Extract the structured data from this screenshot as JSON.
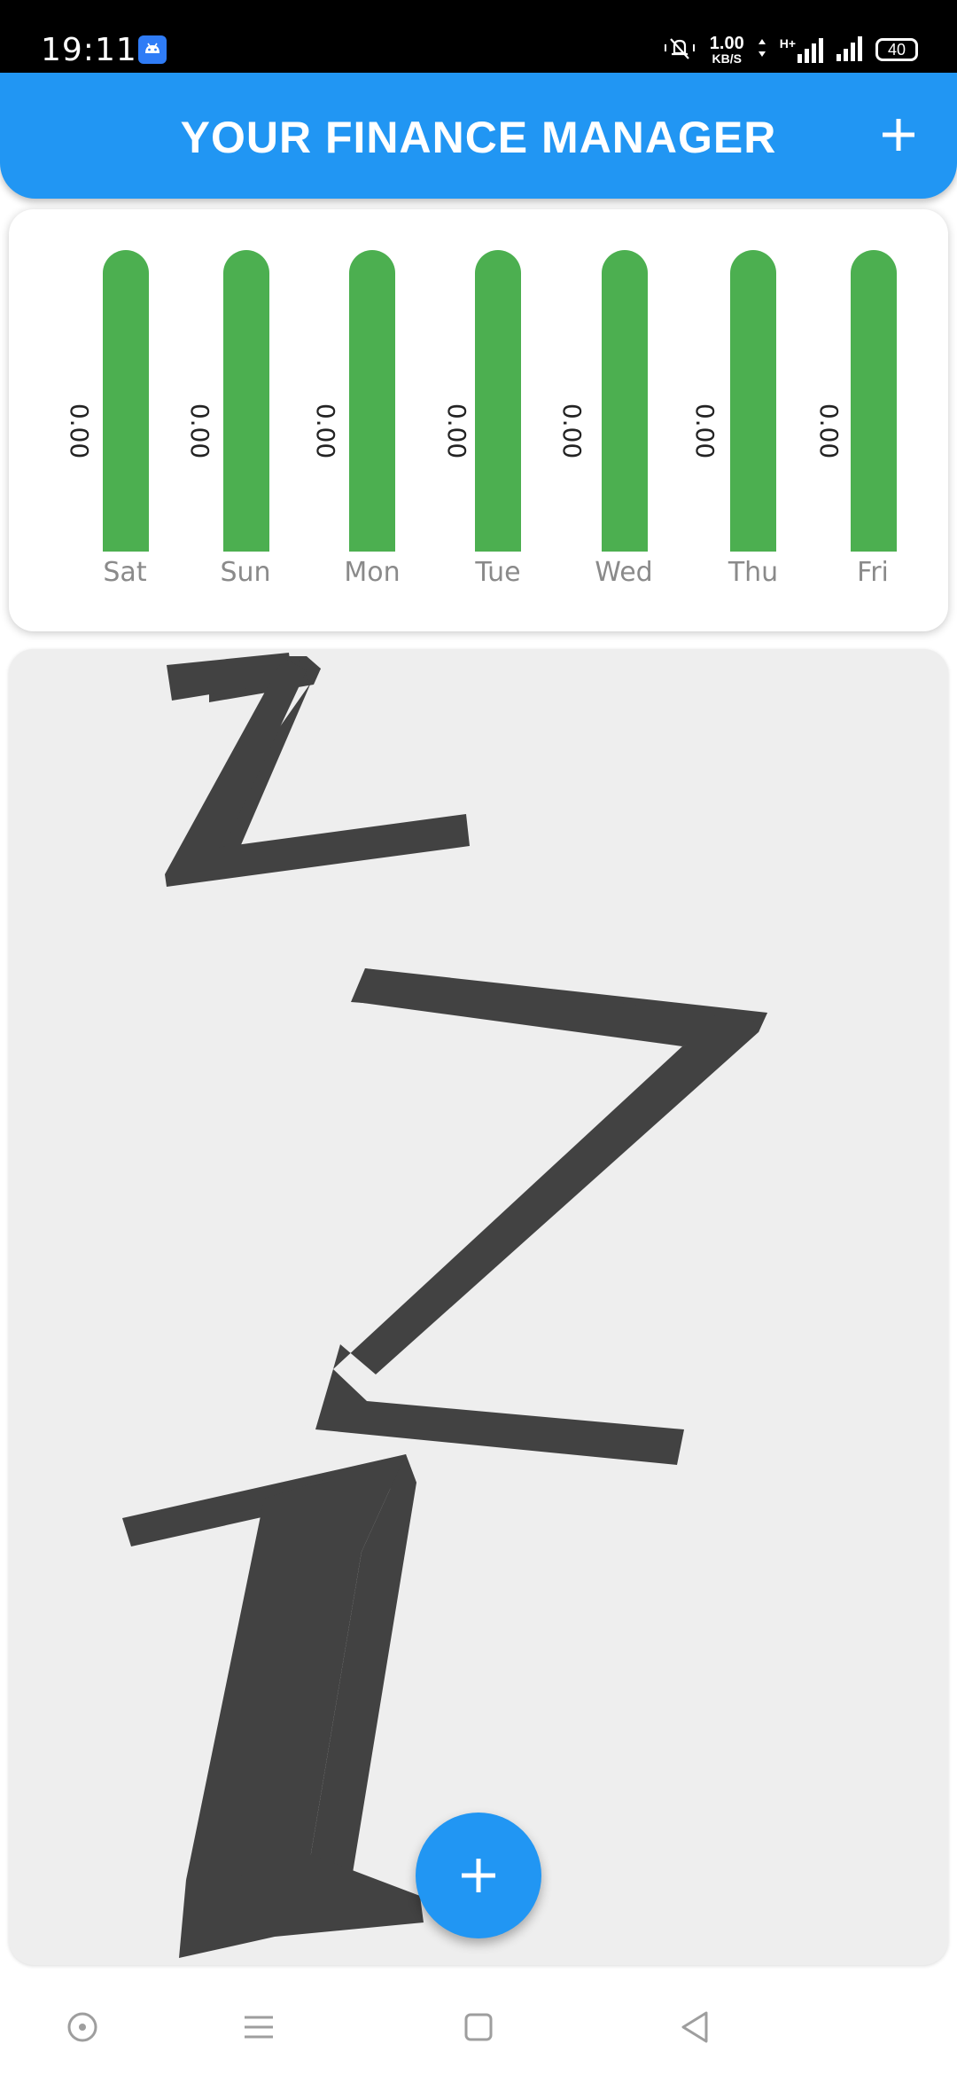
{
  "status_bar": {
    "time": "19:11",
    "net_speed_value": "1.00",
    "net_speed_unit": "KB/S",
    "network_type": "H+",
    "battery": "40"
  },
  "app_bar": {
    "title": "YOUR FINANCE MANAGER"
  },
  "chart_data": {
    "type": "bar",
    "categories": [
      "Sat",
      "Sun",
      "Mon",
      "Tue",
      "Wed",
      "Thu",
      "Fri"
    ],
    "values": [
      0.0,
      0.0,
      0.0,
      0.0,
      0.0,
      0.0,
      0.0
    ],
    "value_labels": [
      "0.00",
      "0.00",
      "0.00",
      "0.00",
      "0.00",
      "0.00",
      "0.00"
    ],
    "bar_color": "#4caf50"
  },
  "empty_state": {
    "icon": "sleep-zzz-icon"
  },
  "colors": {
    "primary": "#2196f3",
    "bar": "#4caf50",
    "empty_bg": "#eeeeee",
    "zzz": "#424242"
  }
}
